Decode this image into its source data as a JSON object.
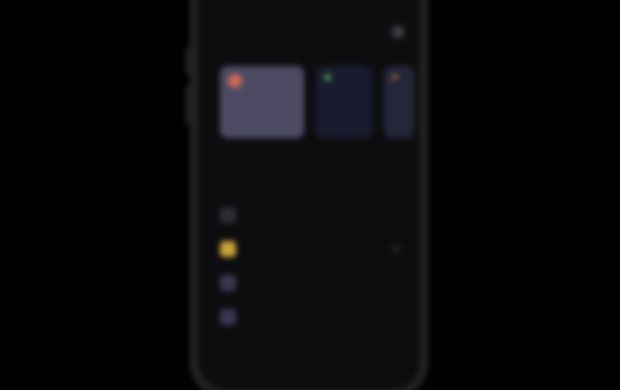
{
  "colors": {
    "background": "#000000",
    "phone_body": "#0d0d10",
    "card_primary": "#4c4b63",
    "card_secondary": "#191c2e",
    "accent_green": "#4f9e4a",
    "accent_orange": "#d06a55",
    "accent_yellow": "#c7a23a"
  },
  "header": {
    "title": "",
    "action_icon": "settings-icon"
  },
  "cards": [
    {
      "icon": "orange-dot-icon",
      "value": ""
    },
    {
      "icon": "green-dot-icon",
      "value": ""
    },
    {
      "icon": "brown-dot-icon",
      "value": ""
    }
  ],
  "section": {
    "title": ""
  },
  "list": [
    {
      "icon": "category-icon",
      "label": "",
      "amount": ""
    },
    {
      "icon": "category-icon-yellow",
      "label": "",
      "amount": ""
    },
    {
      "icon": "category-icon-purple",
      "label": "",
      "amount": ""
    },
    {
      "icon": "category-icon-purple",
      "label": "",
      "amount": ""
    }
  ]
}
